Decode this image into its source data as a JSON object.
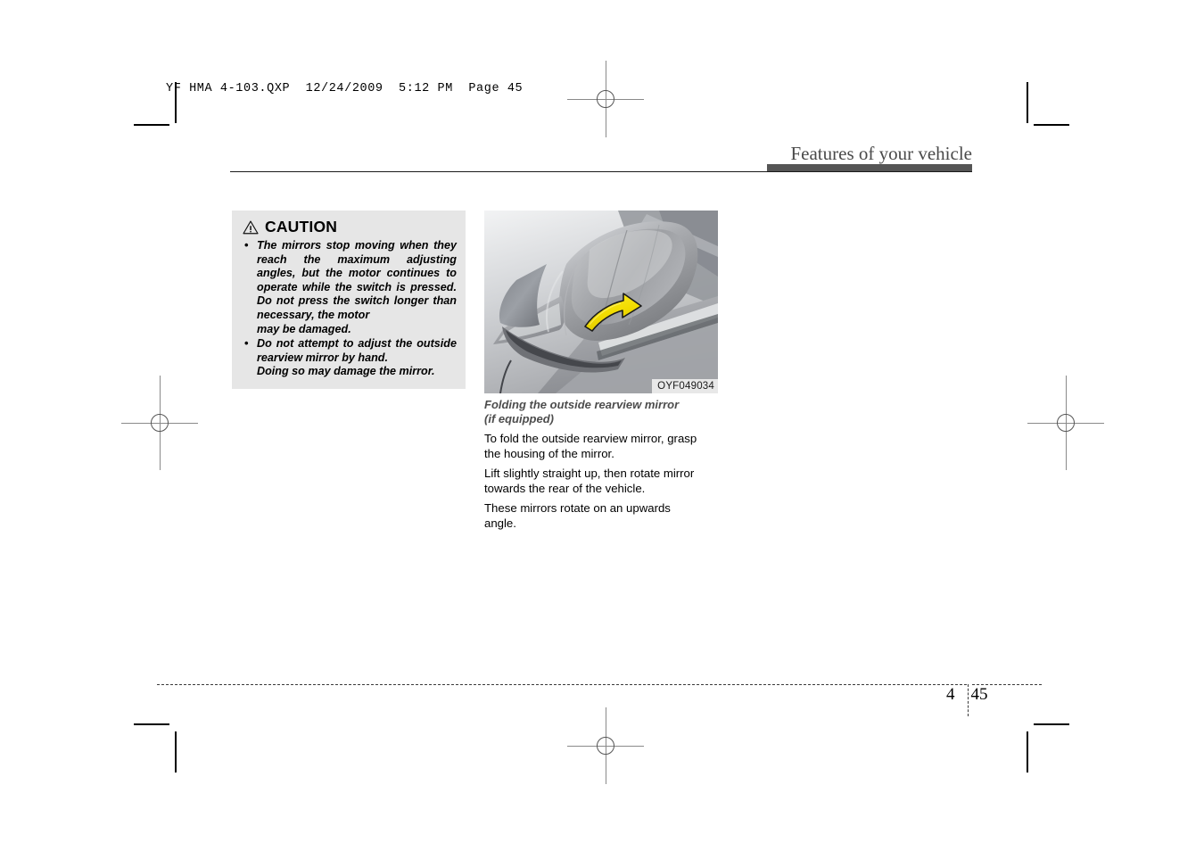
{
  "slug": "YF HMA 4-103.QXP  12/24/2009  5:12 PM  Page 45",
  "header": {
    "title": "Features of your vehicle"
  },
  "caution": {
    "icon": "warning-triangle-icon",
    "label": "CAUTION",
    "items": [
      {
        "text": "The mirrors stop moving when they reach the maximum adjusting angles, but the motor continues to operate while the switch is pressed. Do not press the switch longer than necessary, the motor",
        "last": "may be damaged."
      },
      {
        "text": "Do not attempt to adjust the outside rearview mirror by hand.",
        "last": "Doing so may damage the mirror."
      }
    ]
  },
  "figure": {
    "code": "OYF049034",
    "alt": "outside-rearview-mirror-folding-illustration",
    "arrow_color": "#f5e400"
  },
  "content": {
    "subheading_line1": "Folding the outside rearview mirror",
    "subheading_line2": "(if equipped)",
    "paragraphs": [
      {
        "text": "To fold the outside rearview mirror, grasp",
        "last": "the housing of the mirror."
      },
      {
        "text": "Lift slightly straight up, then rotate mirror",
        "last": "towards the rear of the vehicle."
      },
      {
        "text": "These mirrors rotate on an upwards",
        "last": "angle."
      }
    ]
  },
  "folio": {
    "chapter": "4",
    "page": "45"
  }
}
